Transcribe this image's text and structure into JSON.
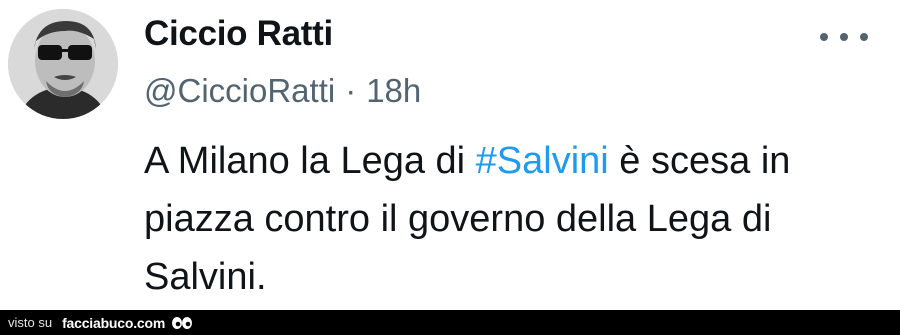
{
  "tweet": {
    "author_name": "Ciccio Ratti",
    "handle": "@CiccioRatti",
    "separator": "·",
    "timestamp": "18h",
    "text_before": "A Milano la Lega di ",
    "hashtag": "#Salvini",
    "text_after": " è scesa in piazza contro il governo della Lega di Salvini.",
    "more_icon": "more-horizontal-icon"
  },
  "watermark": {
    "prefix": "visto su",
    "site": "facciabuco.com",
    "logo_icon": "eyes-logo-icon"
  },
  "colors": {
    "text": "#0f1419",
    "secondary": "#536471",
    "link": "#1d9bf0",
    "footer_bg": "#000000"
  }
}
